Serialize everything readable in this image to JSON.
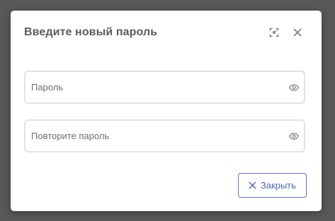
{
  "dialog": {
    "title": "Введите новый пароль",
    "collapse_icon": "collapse-icon",
    "close_icon": "close-icon"
  },
  "fields": [
    {
      "placeholder": "Пароль",
      "value": "",
      "icon": "eye-icon"
    },
    {
      "placeholder": "Повторите пароль",
      "value": "",
      "icon": "eye-icon"
    }
  ],
  "footer": {
    "close_label": "Закрыть",
    "close_icon": "close-icon"
  },
  "colors": {
    "accent": "#4a64b8",
    "backdrop": "#585858",
    "title": "#5c5c5c",
    "border": "#e3e3e3"
  }
}
